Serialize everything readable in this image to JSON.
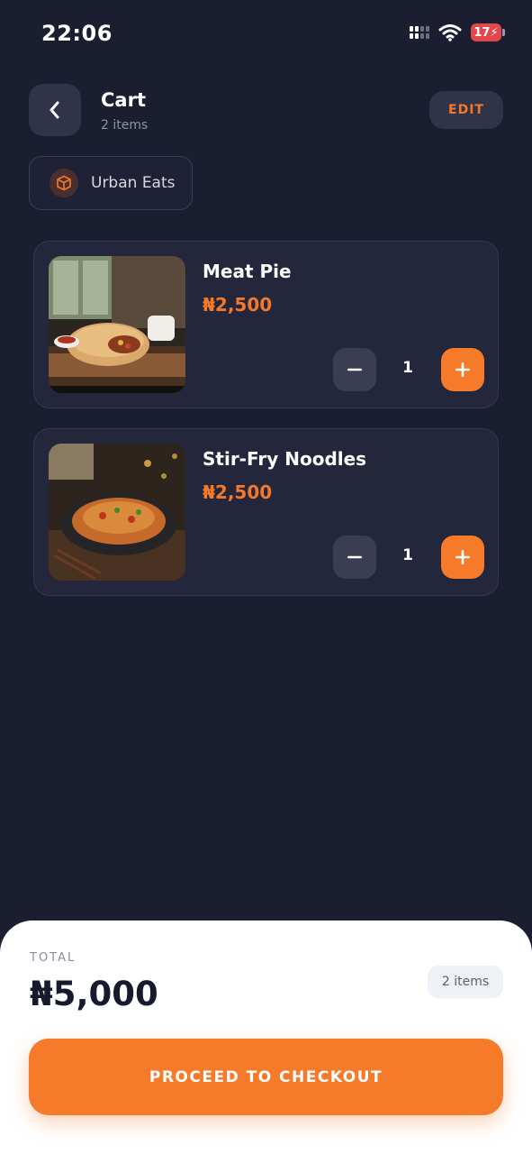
{
  "status_bar": {
    "time": "22:06",
    "battery": "17"
  },
  "header": {
    "title": "Cart",
    "subtitle": "2 items",
    "edit_label": "EDIT"
  },
  "store": {
    "name": "Urban Eats"
  },
  "cart": {
    "items": [
      {
        "name": "Meat Pie",
        "price": "₦2,500",
        "quantity": "1",
        "image_icon": "meat-pie-photo"
      },
      {
        "name": "Stir-Fry Noodles",
        "price": "₦2,500",
        "quantity": "1",
        "image_icon": "noodles-photo"
      }
    ]
  },
  "summary": {
    "total_label": "TOTAL",
    "total_amount": "₦5,000",
    "items_badge": "2 items",
    "checkout_label": "PROCEED TO CHECKOUT"
  },
  "colors": {
    "background": "#1b1e30",
    "card": "#24273b",
    "accent": "#f57a2a",
    "sheet": "#ffffff"
  }
}
